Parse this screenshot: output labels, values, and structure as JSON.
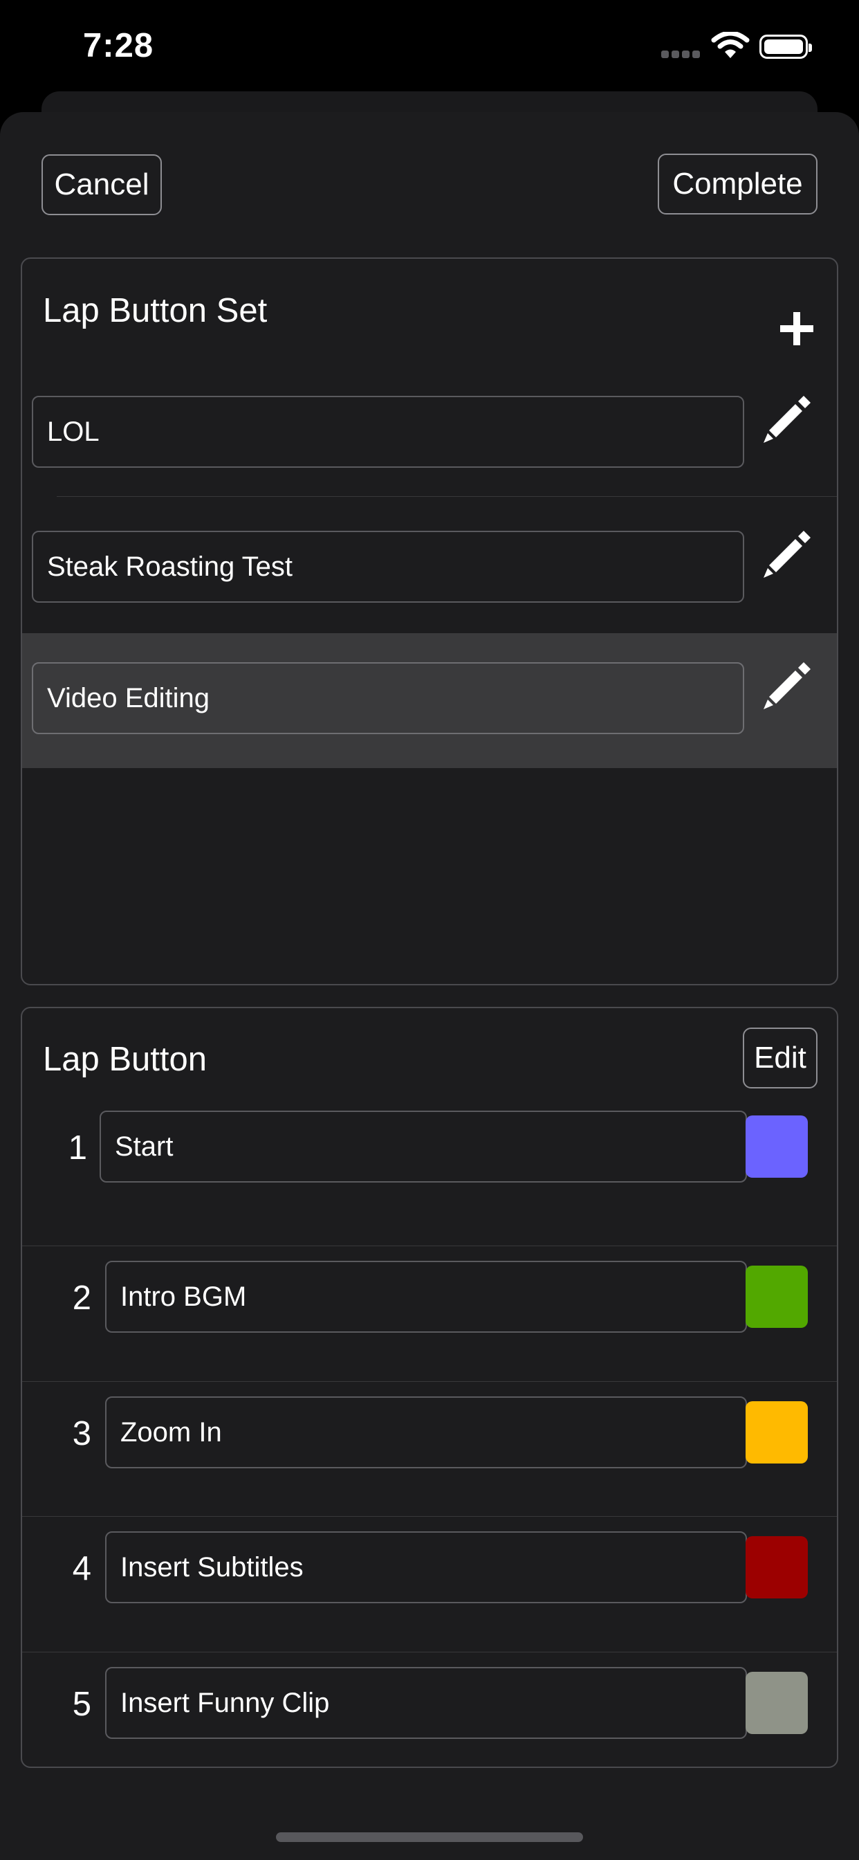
{
  "status": {
    "time": "7:28"
  },
  "toolbar": {
    "cancel_label": "Cancel",
    "complete_label": "Complete"
  },
  "lap_button_set": {
    "title": "Lap Button Set",
    "add_icon": "plus-icon",
    "edit_icon": "pencil-icon",
    "items": [
      {
        "name": "LOL",
        "selected": false
      },
      {
        "name": "Steak Roasting Test",
        "selected": false
      },
      {
        "name": "Video Editing",
        "selected": true
      }
    ]
  },
  "lap_button": {
    "title": "Lap Button",
    "edit_label": "Edit",
    "items": [
      {
        "index": "1",
        "name": "Start",
        "color": "#6b63ff"
      },
      {
        "index": "2",
        "name": "Intro BGM",
        "color": "#52a800"
      },
      {
        "index": "3",
        "name": "Zoom In",
        "color": "#ffba00"
      },
      {
        "index": "4",
        "name": "Insert Subtitles",
        "color": "#9c0000"
      },
      {
        "index": "5",
        "name": "Insert Funny Clip",
        "color": "#8f9388"
      }
    ]
  },
  "colors": {
    "background": "#000000",
    "sheet": "#1c1c1e",
    "selected_row": "#3a3a3c"
  }
}
